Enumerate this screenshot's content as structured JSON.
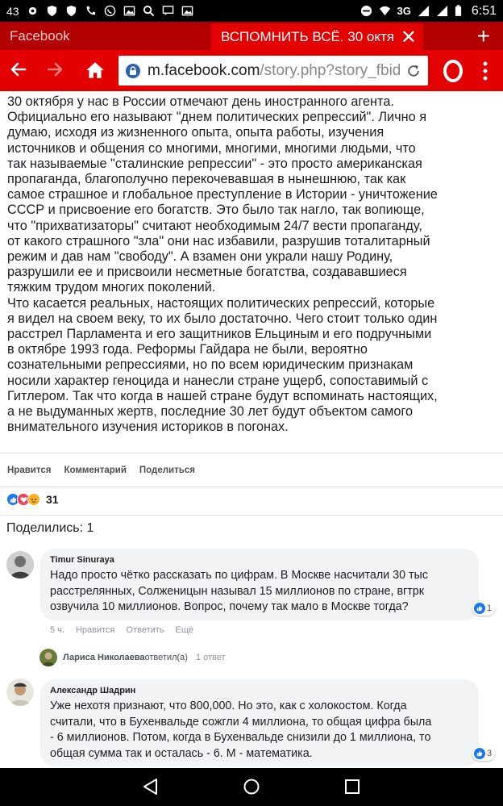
{
  "status_bar": {
    "left_number": "43",
    "network": "3G",
    "time": "6:51"
  },
  "tabs": {
    "inactive_label": "Facebook",
    "active_label": "ВСПОМНИТЬ ВСЁ. 30 октя",
    "close_glyph": "✕",
    "add_glyph": "+"
  },
  "address_bar": {
    "host": "m.facebook.com",
    "path": "/story.php?story_fbid"
  },
  "post": {
    "text": "30 октября у нас в России отмечают день иностранного агента.\nОфициально его называют \"днем политических репрессий\". Лично я\nдумаю, исходя из жизненного опыта, опыта работы, изучения\nисточников и общения со многими, многими, многими людьми, что\nтак называемые \"сталинские репрессии\" - это просто американская\nпропаганда, благополучно перекочевавшая в нынешнюю, так как\nсамое страшное и глобальное преступление в Истории - уничтожение\nСССР и присвоение его богатств. Это было так нагло, так вопиюще,\nчто \"прихватизаторы\" считают необходимым 24/7 вести пропаганду,\nот какого страшного \"зла\" они нас избавили, разрушив тоталитарный\nрежим и дав нам \"свободу\". А взамен они украли нашу Родину,\nразрушили ее и присвоили несметные богатства, создававшиеся\nтяжким трудом многих поколений.\nЧто касается реальных, настоящих политических репрессий, которые\nя видел на своем веку, то их было достаточно. Чего стоит только один\nрасстрел Парламента и его защитников Ельциным и его подручными\nв октябре 1993 года. Реформы Гайдара не были, вероятно\nсознательными репрессиями, но по всем юридическим признакам\nносили характер геноцида и нанесли стране ущерб, сопоставимый с\nГитлером. Так что когда в нашей стране будут вспоминать настоящих,\nа не выдуманных жертв, последние 30 лет будут объектом самого\nвнимательного изучения историков в погонах.",
    "actions": {
      "like": "Нравится",
      "comment": "Комментарий",
      "share": "Поделиться"
    },
    "reaction_count": "31",
    "shares": "Поделились: 1"
  },
  "comments": [
    {
      "name": "Timur Sinuraya",
      "text": "Надо просто чётко рассказать по цифрам. В Москве насчитали 30 тыс\nрасстрелянных, Солженицын называл 15 миллионов по стране, вгтрк\nозвучила 10 миллионов. Вопрос, почему так мало в Москве тогда?",
      "likes": "1",
      "time": "5 ч.",
      "like": "Нравится",
      "reply": "Ответить",
      "more": "Ещё",
      "reply_summary": {
        "name": "Лариса Николаева",
        "verb": " ответил(а)",
        "count": "1 ответ"
      }
    },
    {
      "name": "Александр Шадрин",
      "text": "Уже нехотя признают, что 800,000. Но это, как с холокостом. Когда\nсчитали, что в Бухенвальде сожгли 4 миллиона, то общая цифра была\n- 6 миллионов. Потом, когда в Бухенвальде снизили до 1 миллиона, то\nобщая сумма так и осталась - 6. М - математика.",
      "likes": "3"
    }
  ],
  "colors": {
    "tab_bar": "#b20000",
    "toolbar": "#e20000",
    "like_blue": "#1877f2",
    "love_red": "#f33e58",
    "angry_orange": "#f7b125"
  }
}
